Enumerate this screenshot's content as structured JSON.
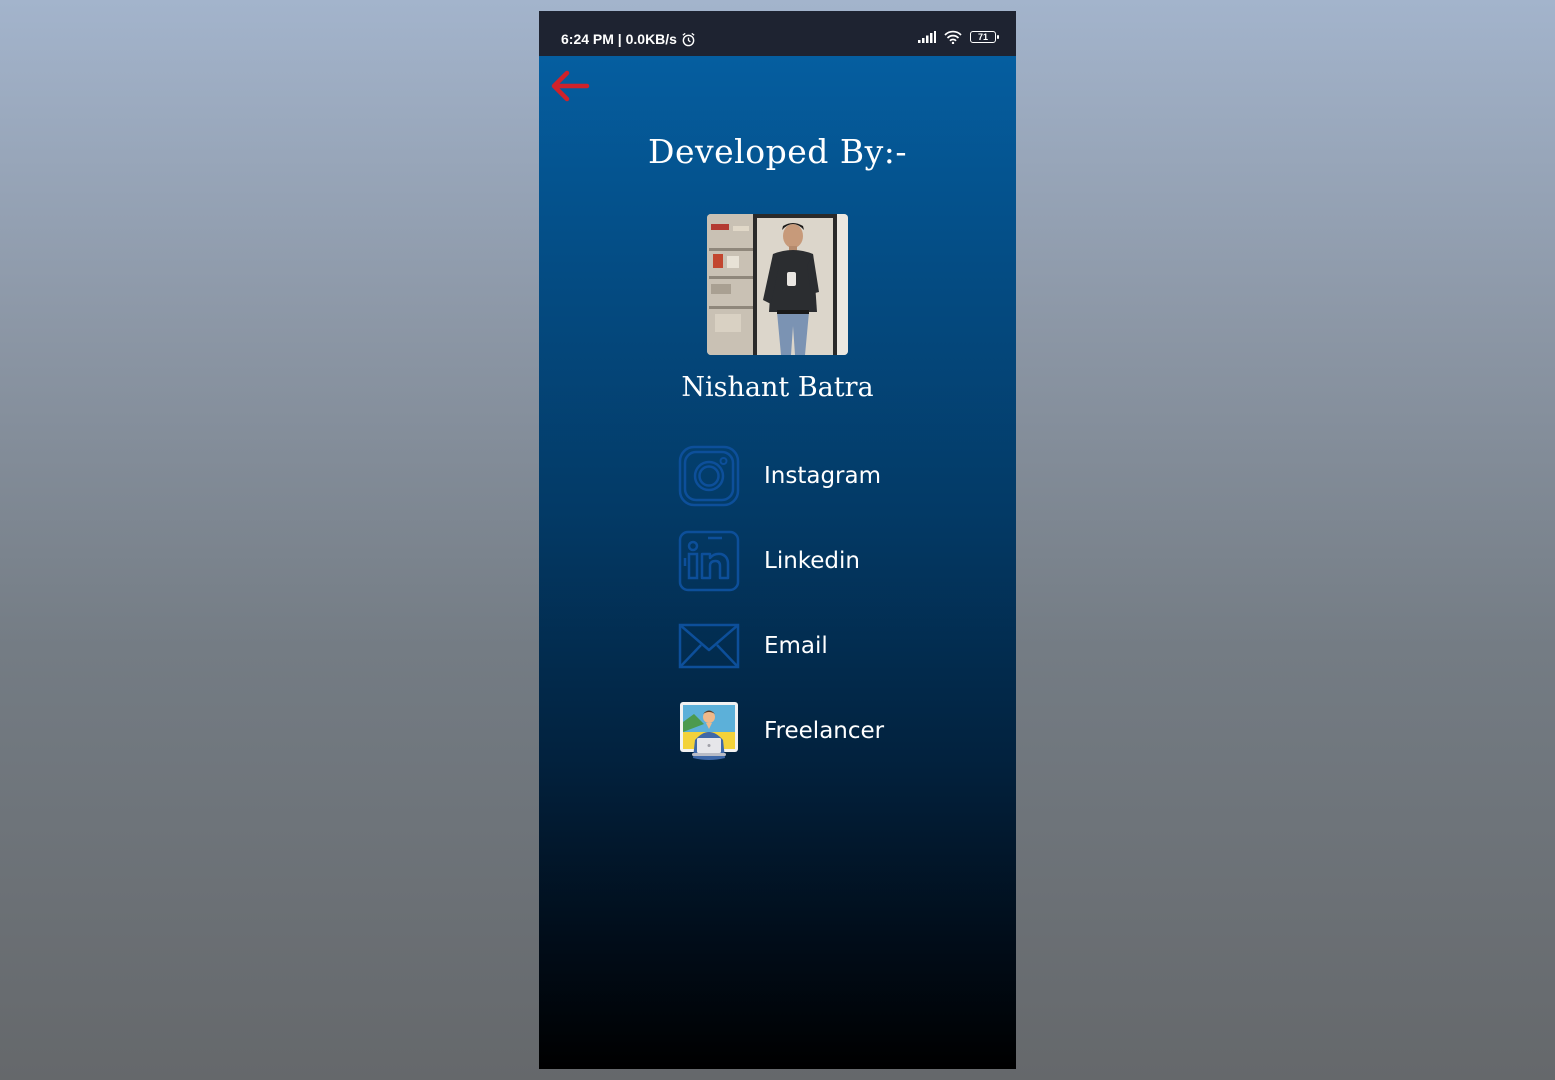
{
  "status_bar": {
    "time_speed": "6:24 PM | 0.0KB/s",
    "battery_level": "71"
  },
  "screen": {
    "title": "Developed By:-",
    "developer_name": "Nishant Batra",
    "links": [
      {
        "label": "Instagram",
        "icon": "instagram-icon"
      },
      {
        "label": "Linkedin",
        "icon": "linkedin-icon"
      },
      {
        "label": "Email",
        "icon": "email-icon"
      },
      {
        "label": "Freelancer",
        "icon": "freelancer-icon"
      }
    ]
  },
  "colors": {
    "back_arrow": "#d0222a",
    "icon_outline": "#0d4f9a",
    "gradient_top": "#055ea0",
    "gradient_bottom": "#000000",
    "status_bar_bg": "#1e2331"
  }
}
